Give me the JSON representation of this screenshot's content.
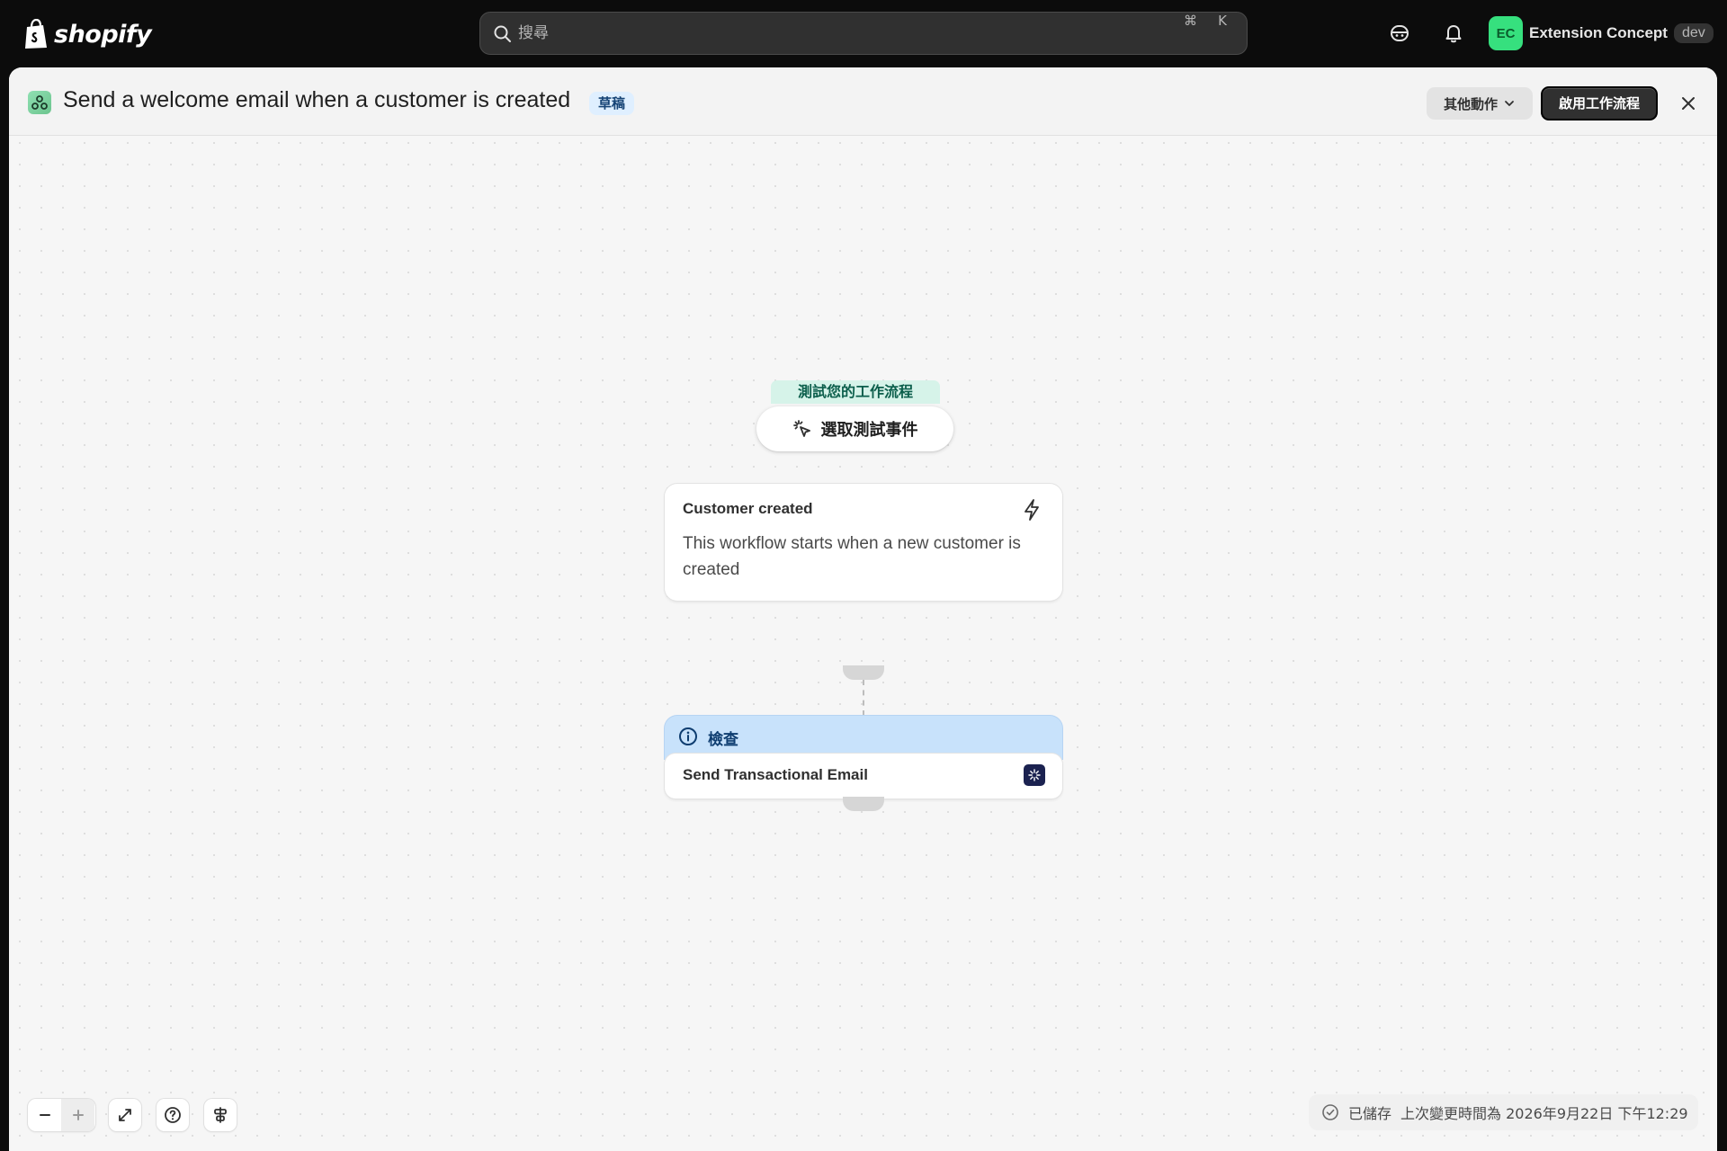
{
  "topbar": {
    "brand": "shopify",
    "search_placeholder": "搜尋",
    "shortcut_cmd": "⌘",
    "shortcut_key": "K",
    "store_initials": "EC",
    "store_name": "Extension Concept",
    "store_env": "dev"
  },
  "header": {
    "title": "Send a welcome email when a customer is created",
    "status_badge": "草稿",
    "more_actions": "其他動作",
    "enable_button": "啟用工作流程"
  },
  "canvas": {
    "test_label": "測試您的工作流程",
    "test_button": "選取測試事件",
    "trigger": {
      "title": "Customer created",
      "description": "This workflow starts when a new customer is created"
    },
    "action": {
      "check_label": "檢查",
      "title": "Send Transactional Email"
    }
  },
  "footer": {
    "saved_label": "已儲存",
    "last_modified": "上次變更時間為 2026年9月22日 下午12:29"
  },
  "colors": {
    "topbar_bg": "#0c0c0c",
    "canvas_bg": "#f6f6f6",
    "draft_badge_bg": "#dfefff",
    "test_pill_bg": "#d6f3e9",
    "check_bar_bg": "#c8e2fb",
    "avatar_bg": "#36e07e"
  }
}
